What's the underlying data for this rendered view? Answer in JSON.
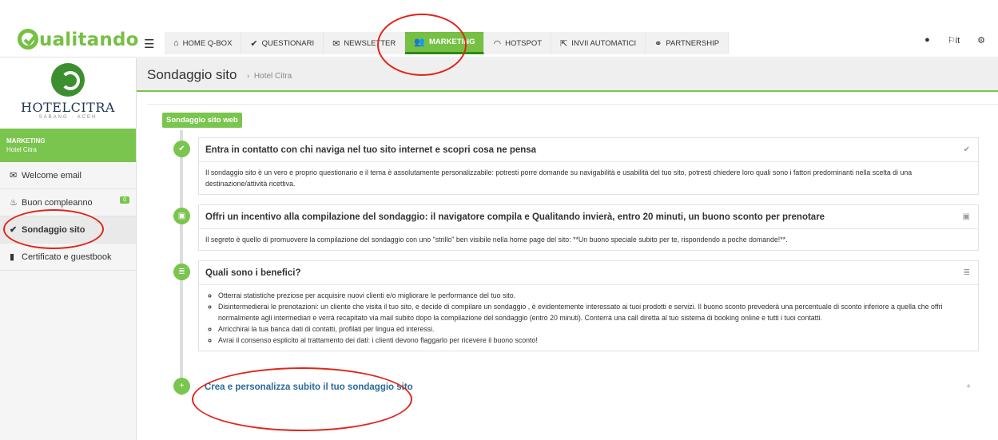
{
  "app": {
    "logo_text": "ualitando"
  },
  "nav": {
    "items": [
      {
        "label": "HOME Q-BOX",
        "icon": "home-icon",
        "glyph": "🏠"
      },
      {
        "label": "QUESTIONARI",
        "icon": "check-icon",
        "glyph": "✔"
      },
      {
        "label": "NEWSLETTER",
        "icon": "envelope-icon",
        "glyph": "✉"
      },
      {
        "label": "MARKETING",
        "icon": "users-icon",
        "glyph": "👥",
        "active": true
      },
      {
        "label": "HOTSPOT",
        "icon": "wifi-icon",
        "glyph": "📶"
      },
      {
        "label": "INVII AUTOMATICI",
        "icon": "share-icon",
        "glyph": "⇱"
      },
      {
        "label": "PARTNERSHIP",
        "icon": "handshake-icon",
        "glyph": "🤝"
      }
    ],
    "lang": "it"
  },
  "sidebar": {
    "hotel_name": "HOTELCITRA",
    "hotel_sub": "SABANG · ACEH",
    "section": "MARKETING",
    "section_sub": "Hotel Citra",
    "items": [
      {
        "label": "Welcome email",
        "icon": "envelope-icon",
        "glyph": "✉"
      },
      {
        "label": "Buon compleanno",
        "icon": "cake-icon",
        "glyph": "🎂",
        "badge": "0"
      },
      {
        "label": "Sondaggio sito",
        "icon": "check-icon",
        "glyph": "✔",
        "active": true
      },
      {
        "label": "Certificato e guestbook",
        "icon": "book-icon",
        "glyph": "📘"
      }
    ]
  },
  "page": {
    "title": "Sondaggio sito",
    "breadcrumb": "Hotel Citra",
    "section_tag": "Sondaggio sito web"
  },
  "timeline": {
    "card1": {
      "title": "Entra in contatto con chi naviga nel tuo sito internet e scopri cosa ne pensa",
      "body": "Il sondaggio sito è un vero e proprio questionario e il tema è assolutamente personalizzabile: potresti porre domande su navigabilità e usabilità del tuo sito, potresti chiedere loro quali sono i fattori predominanti nella scelta di una destinazione/attività ricettiva."
    },
    "card2": {
      "title": "Offri un incentivo alla compilazione del sondaggio: il navigatore compila e Qualitando invierà, entro 20 minuti, un buono sconto per prenotare",
      "body": "Il segreto è quello di promuovere la compilazione del sondaggio con uno \"strillo\" ben visibile nella home page del sito: **Un buono speciale subito per te, rispondendo a poche domande!**."
    },
    "card3": {
      "title": "Quali sono i benefici?",
      "bullets": [
        "Otterrai statistiche preziose per acquisire nuovi clienti e/o migliorare le performance del tuo sito.",
        "Disintermedierai le prenotazioni: un cliente che visita il tuo sito, e decide di compilare un sondaggio , è evidentemente interessato ai tuoi prodotti e servizi. Il buono sconto prevederà una percentuale di sconto inferiore a quella che offri normalmente agli intermediari e verrà recapitato via mail subito dopo la compilazione del sondaggio (entro 20 minuti). Conterrà una call diretta al tuo sistema di booking online e tutti i tuoi contatti.",
        "Arricchirai la tua banca dati di contatti, profilati per lingua ed interessi.",
        "Avrai il consenso esplicito al trattamento dei dati: i clienti devono flaggarlo per ricevere il buono sconto!"
      ]
    },
    "card4": {
      "title": "Crea e personalizza subito il tuo sondaggio sito"
    }
  }
}
